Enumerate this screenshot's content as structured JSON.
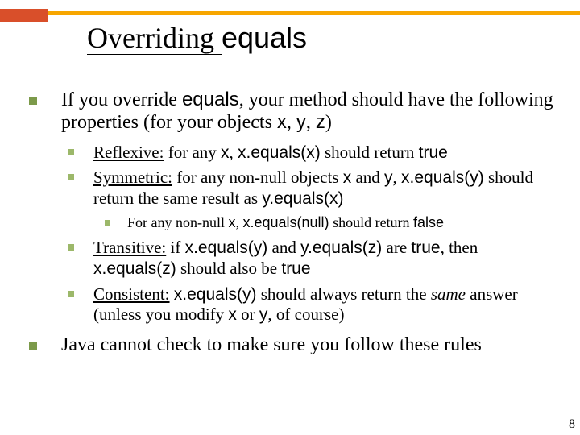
{
  "title": {
    "prefix": "Overriding ",
    "code": "equals"
  },
  "intro": {
    "p1": "If you override ",
    "p1code": "equals",
    "p2": ", your method should have the following properties (for your objects ",
    "x": "x",
    "y": "y",
    "z": "z",
    "close": ")"
  },
  "props": {
    "reflexive": {
      "label": "Reflexive:",
      "t1": " for any ",
      "x": "x",
      "t2": ", ",
      "call": "x.equals(x)",
      "t3": " should return ",
      "true": "true"
    },
    "symmetric": {
      "label": "Symmetric:",
      "t1": " for any non-null objects ",
      "x": "x",
      "t2": " and ",
      "y": "y",
      "t3": ", ",
      "call1": "x.equals(y)",
      "t4": " should return the same result as ",
      "call2": "y.equals(x)"
    },
    "nullnote": {
      "t1": "For any non-null ",
      "x": "x",
      "t2": ", ",
      "call": "x.equals(null)",
      "t3": " should return ",
      "false": "false"
    },
    "transitive": {
      "label": "Transitive:",
      "t1": " if ",
      "call1": "x.equals(y)",
      "t2": " and ",
      "call2": "y.equals(z)",
      "t3": " are ",
      "true1": "true",
      "t4": ", then ",
      "call3": "x.equals(z)",
      "t5": " should also be ",
      "true2": "true"
    },
    "consistent": {
      "label": "Consistent:",
      "t1": " ",
      "call": "x.equals(y)",
      "t2": " should always return the ",
      "same": "same",
      "t3": " answer (unless you modify ",
      "x": "x",
      "t4": " or ",
      "y": "y",
      "t5": ", of course)"
    }
  },
  "closing": "Java cannot check to make sure you follow these rules",
  "page": "8"
}
